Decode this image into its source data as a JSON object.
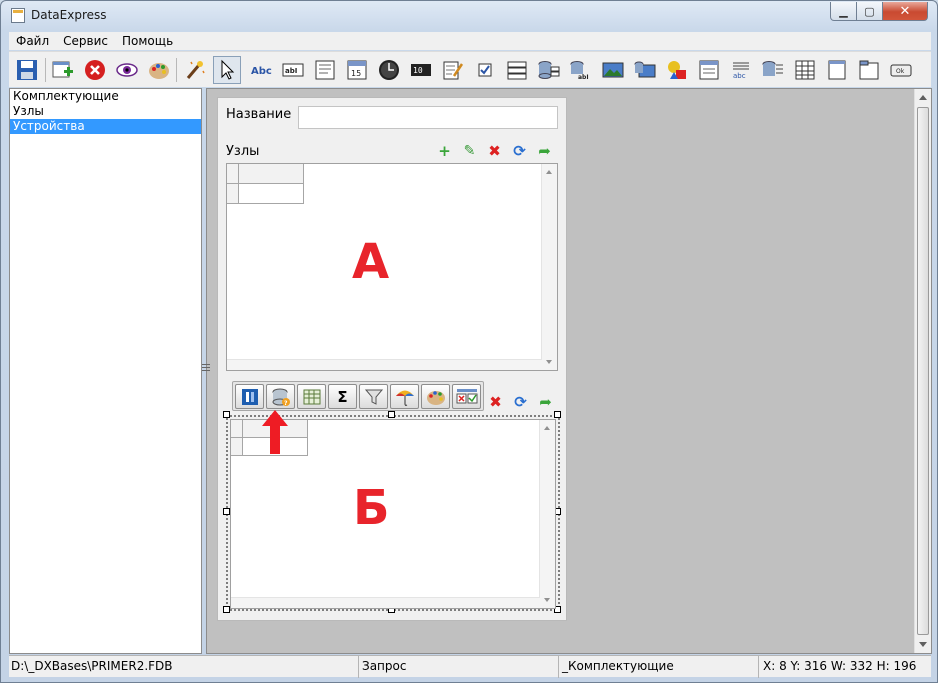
{
  "window": {
    "title": "DataExpress"
  },
  "menu": {
    "items": [
      "Файл",
      "Сервис",
      "Помощь"
    ]
  },
  "toolbar": {
    "items": [
      "save-icon",
      "new-form-icon",
      "delete-form-icon",
      "preview-eye-icon",
      "palette-icon",
      "magic-wand-icon",
      "pointer-icon",
      "label-abc-icon",
      "text-field-icon",
      "memo-icon",
      "date-icon",
      "time-clock-icon",
      "number-icon",
      "edit-note-icon",
      "checkbox-icon",
      "combobox-icon",
      "db-combobox-icon",
      "db-lookup-icon",
      "image-icon",
      "db-image-icon",
      "shapes-icon",
      "grid-form-icon",
      "abc-list-icon",
      "db-list-icon",
      "table-grid-icon",
      "page-icon",
      "tab-page-icon",
      "ok-button-icon"
    ]
  },
  "tree": {
    "items": [
      {
        "label": "Комплектующие",
        "selected": false
      },
      {
        "label": "Узлы",
        "selected": false
      },
      {
        "label": "Устройства",
        "selected": true
      }
    ]
  },
  "form": {
    "name_label": "Название",
    "name_value": "",
    "uzly_label": "Узлы",
    "grid_a_marker": "А",
    "grid_b_marker": "Б",
    "float_toolbar_text_sigma": "Σ"
  },
  "status": {
    "path": "D:\\_DXBases\\PRIMER2.FDB",
    "mode": "Запрос",
    "table": "_Комплектующие",
    "coords": "X: 8 Y: 316 W: 332 H: 196"
  },
  "colors": {
    "selection": "#3399ff",
    "marker_red": "#e8242b",
    "designer_bg": "#c0c0c0"
  }
}
